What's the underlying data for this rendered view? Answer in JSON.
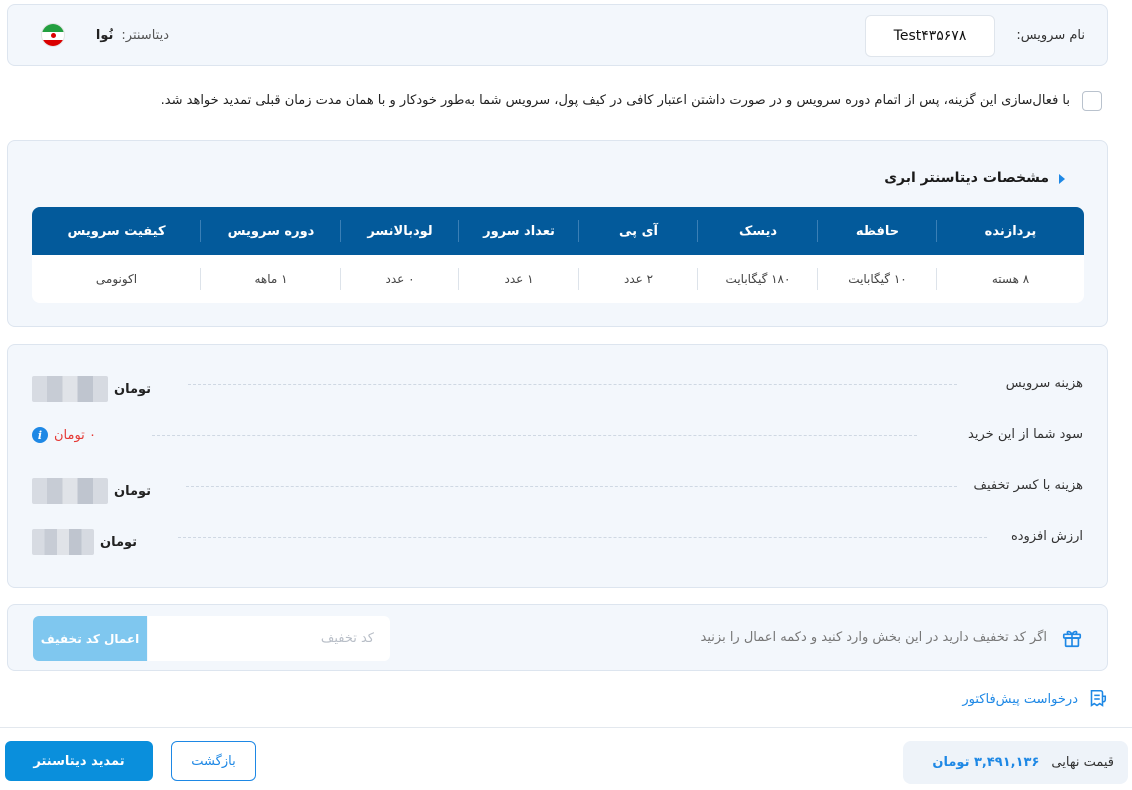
{
  "service": {
    "name_label": "نام سرویس:",
    "name_value": "Test۴۳۵۶۷۸",
    "datacenter_label": "دیتاسنتر:",
    "datacenter_value": "نُوا",
    "flag_icon": "iran-flag-icon"
  },
  "auto_renew": {
    "text": "با فعال‌سازی این گزینه، پس از اتمام دوره سرویس و در صورت داشتن اعتبار کافی در کیف پول، سرویس شما به‌طور خودکار و با همان مدت زمان قبلی تمدید خواهد شد.",
    "checked": false
  },
  "specs": {
    "title": "مشخصات دیتاسنتر ابری",
    "headers": [
      "پردازنده",
      "حافظه",
      "دیسک",
      "آی پی",
      "تعداد سرور",
      "لودبالانسر",
      "دوره سرویس",
      "کیفیت سرویس"
    ],
    "values": [
      "۸ هسته",
      "۱۰ گیگابایت",
      "۱۸۰ گیگابایت",
      "۲ عدد",
      "۱ عدد",
      "۰ عدد",
      "۱ ماهه",
      "اکونومی"
    ]
  },
  "costs": {
    "service_cost_label": "هزینه سرویس",
    "profit_label": "سود شما از این خرید",
    "discounted_cost_label": "هزینه با کسر تخفیف",
    "vat_label": "ارزش افزوده",
    "currency": "تومان",
    "profit_value": "۰ تومان"
  },
  "discount": {
    "hint": "اگر کد تخفیف دارید در این بخش وارد کنید و دکمه اعمال را بزنید",
    "placeholder": "کد تخفیف",
    "apply_label": "اعمال کد تخفیف"
  },
  "invoice_link": "درخواست پیش‌فاکتور",
  "final": {
    "label": "قیمت نهایی",
    "value": "۳,۴۹۱,۱۳۶ تومان"
  },
  "buttons": {
    "back": "بازگشت",
    "renew": "تمدید دیتاسنتر"
  },
  "colors": {
    "table_header": "#035a9b",
    "accent": "#1e88e5",
    "primary_button": "#0a8fdc",
    "profit": "#e53935"
  }
}
